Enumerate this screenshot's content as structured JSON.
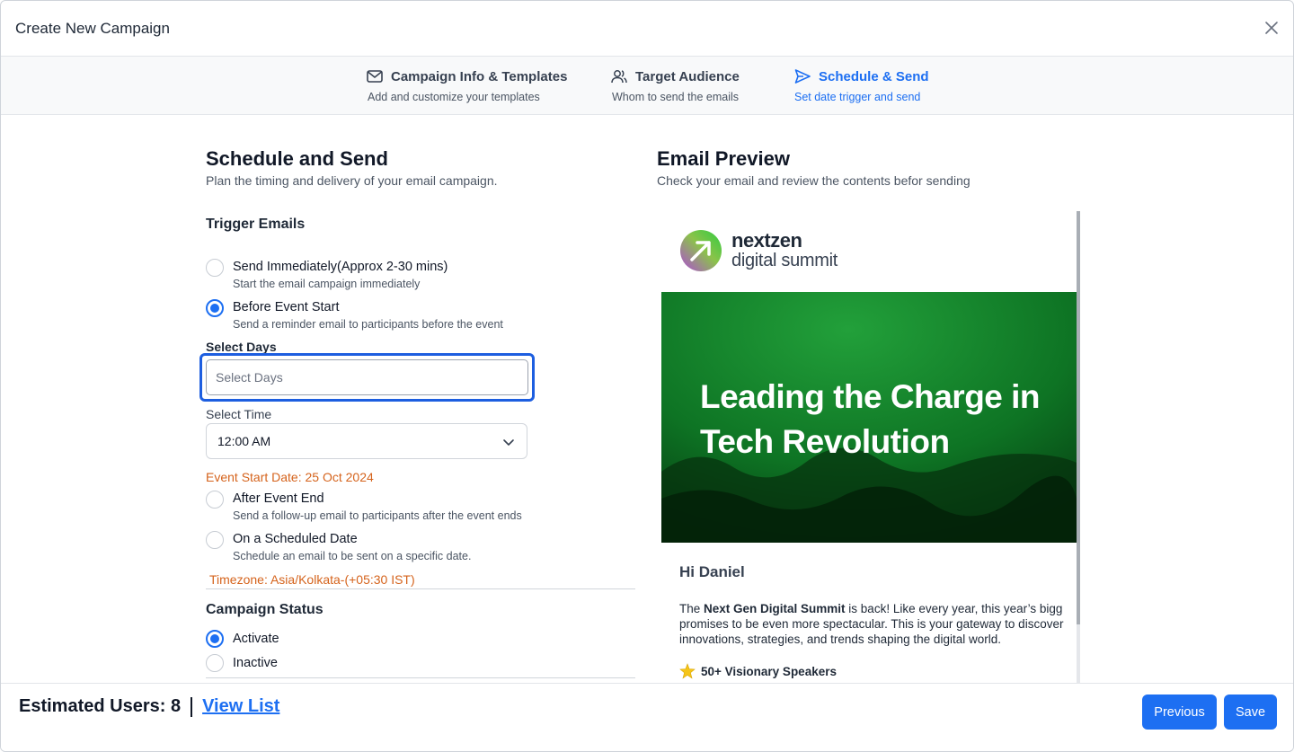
{
  "modal": {
    "title": "Create New Campaign"
  },
  "steps": [
    {
      "title": "Campaign Info & Templates",
      "subtitle": "Add and customize your templates",
      "icon": "mail-icon"
    },
    {
      "title": "Target Audience",
      "subtitle": "Whom to send the emails",
      "icon": "users-icon"
    },
    {
      "title": "Schedule & Send",
      "subtitle": "Set date trigger and send",
      "icon": "send-icon",
      "active": true
    }
  ],
  "schedule": {
    "title": "Schedule and Send",
    "subtitle": "Plan the timing and delivery of your email campaign.",
    "trigger_heading": "Trigger Emails",
    "options": [
      {
        "label": "Send Immediately(Approx 2-30 mins)",
        "desc": "Start the email campaign immediately",
        "checked": false
      },
      {
        "label": "Before Event Start",
        "desc": "Send a reminder email to participants before the event",
        "checked": true
      },
      {
        "label": "After Event End",
        "desc": "Send a follow-up email to participants after the event ends",
        "checked": false
      },
      {
        "label": "On a Scheduled Date",
        "desc": "Schedule an email to be sent on a specific date.",
        "checked": false
      }
    ],
    "select_days_label": "Select Days",
    "select_days_placeholder": "Select Days",
    "select_time_label": "Select Time",
    "select_time_value": "12:00 AM",
    "event_start": "Event Start Date: 25 Oct 2024",
    "timezone": "Timezone: Asia/Kolkata-(+05:30 IST)",
    "status_heading": "Campaign Status",
    "status_options": [
      {
        "label": "Activate",
        "checked": true
      },
      {
        "label": "Inactive",
        "checked": false
      }
    ]
  },
  "preview": {
    "title": "Email Preview",
    "subtitle": "Check your email and review the contents befor sending",
    "logo_line1": "nextzen",
    "logo_line2": "digital summit",
    "banner_line1": "Leading the Charge in",
    "banner_line2": "Tech Revolution",
    "greeting": "Hi Daniel",
    "para_prefix": "The ",
    "para_bold": "Next Gen Digital Summit",
    "para_rest1": " is back! Like every year, this year’s bigg",
    "para_line2": "promises to be even more spectacular. This is your gateway to discover",
    "para_line3": "innovations, strategies, and trends shaping the digital world.",
    "feature1": "50+ Visionary Speakers",
    "colors": {
      "banner_green": "#0b6a1f",
      "accent": "#1d6ff2",
      "orange": "#d5631c"
    }
  },
  "footer": {
    "estimated": "Estimated Users: 8",
    "view_list": "View List",
    "previous": "Previous",
    "save": "Save"
  }
}
